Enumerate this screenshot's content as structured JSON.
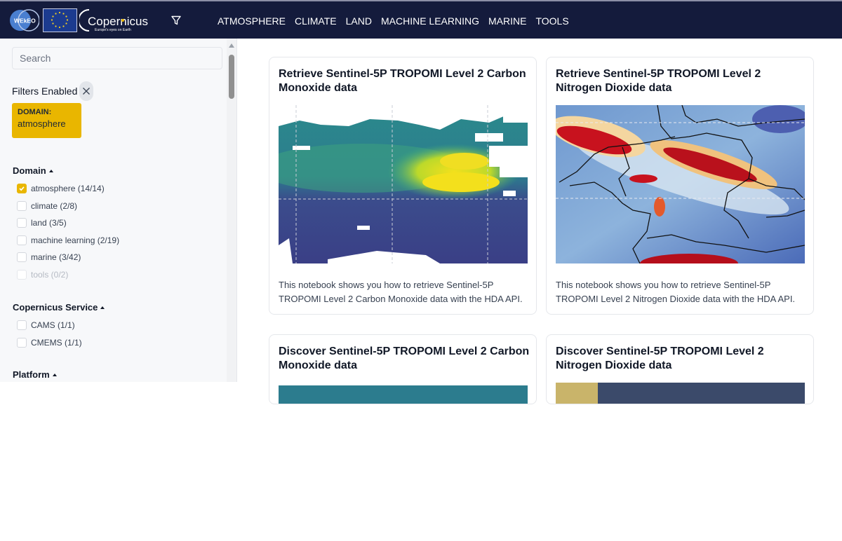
{
  "header": {
    "logos": {
      "wekeo": "WEkEO",
      "eu": "EU flag",
      "copernicus": "Copernicus",
      "copernicus_tagline": "Europe's eyes on Earth"
    },
    "nav": [
      "ATMOSPHERE",
      "CLIMATE",
      "LAND",
      "MACHINE LEARNING",
      "MARINE",
      "TOOLS"
    ]
  },
  "sidebar": {
    "search_placeholder": "Search",
    "filters_enabled_label": "Filters Enabled",
    "active_filter": {
      "key": "DOMAIN:",
      "value": "atmosphere"
    },
    "sections": [
      {
        "title": "Domain",
        "options": [
          {
            "label": "atmosphere (14/14)",
            "checked": true,
            "disabled": false
          },
          {
            "label": "climate (2/8)",
            "checked": false,
            "disabled": false
          },
          {
            "label": "land (3/5)",
            "checked": false,
            "disabled": false
          },
          {
            "label": "machine learning (2/19)",
            "checked": false,
            "disabled": false
          },
          {
            "label": "marine (3/42)",
            "checked": false,
            "disabled": false
          },
          {
            "label": "tools (0/2)",
            "checked": false,
            "disabled": true
          }
        ]
      },
      {
        "title": "Copernicus Service",
        "options": [
          {
            "label": "CAMS (1/1)",
            "checked": false,
            "disabled": false
          },
          {
            "label": "CMEMS (1/1)",
            "checked": false,
            "disabled": false
          }
        ]
      },
      {
        "title": "Platform",
        "options": []
      }
    ]
  },
  "cards": [
    {
      "title": "Retrieve Sentinel-5P TROPOMI Level 2 Carbon Monoxide data",
      "description": "This notebook shows you how to retrieve Sentinel-5P TROPOMI Level 2 Carbon Monoxide data with the HDA API.",
      "image": "carbon-monoxide-map"
    },
    {
      "title": "Retrieve Sentinel-5P TROPOMI Level 2 Nitrogen Dioxide data",
      "description": "This notebook shows you how to retrieve Sentinel-5P TROPOMI Level 2 Nitrogen Dioxide data with the HDA API.",
      "image": "nitrogen-dioxide-map"
    },
    {
      "title": "Discover Sentinel-5P TROPOMI Level 2 Carbon Monoxide data",
      "description": "",
      "image": "carbon-monoxide-map"
    },
    {
      "title": "Discover Sentinel-5P TROPOMI Level 2 Nitrogen Dioxide data",
      "description": "",
      "image": "nitrogen-dioxide-map"
    }
  ],
  "colors": {
    "header_bg": "#141b3c",
    "accent": "#e9b600"
  }
}
